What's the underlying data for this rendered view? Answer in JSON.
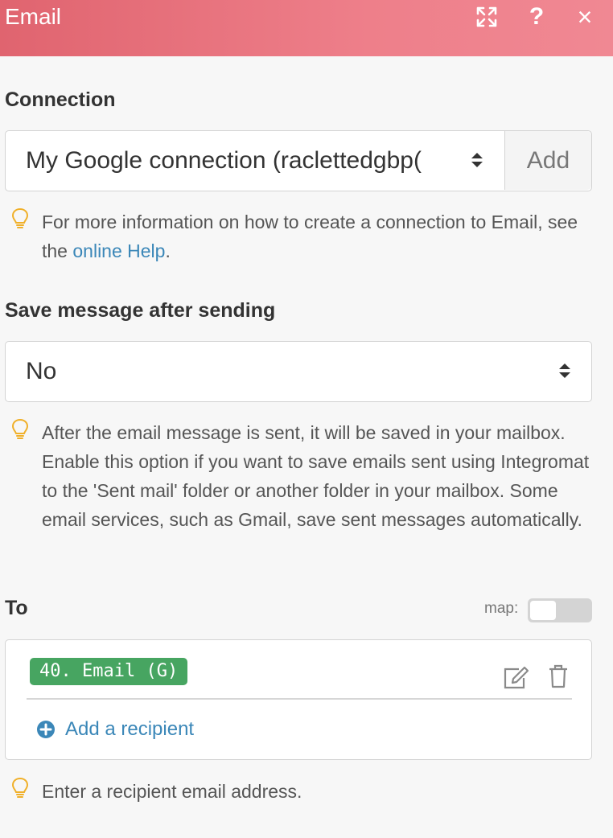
{
  "header": {
    "title": "Email",
    "icons": [
      "expand-icon",
      "help-icon",
      "close-icon"
    ],
    "help_glyph": "?",
    "close_glyph": "×"
  },
  "connection": {
    "label": "Connection",
    "selected": "My Google connection (raclettedgbp(",
    "add_label": "Add",
    "hint_prefix": "For more information on how to create a connection to Email, see the ",
    "hint_link": "online Help",
    "hint_suffix": "."
  },
  "save_message": {
    "label": "Save message after sending",
    "selected": "No",
    "hint": "After the email message is sent, it will be saved in your mailbox. Enable this option if you want to save emails sent using Integromat to the 'Sent mail' folder or another folder in your mailbox. Some email services, such as Gmail, save sent messages automatically."
  },
  "to": {
    "label": "To",
    "map_label": "map:",
    "map_enabled": false,
    "recipients": [
      {
        "value": "40. Email (G)"
      }
    ],
    "add_recipient_label": "Add a recipient",
    "hint": "Enter a recipient email address."
  },
  "colors": {
    "header_start": "#e0646f",
    "header_end": "#f08893",
    "link": "#3b87b8",
    "pill": "#47a561",
    "bulb": "#f0b02a"
  }
}
